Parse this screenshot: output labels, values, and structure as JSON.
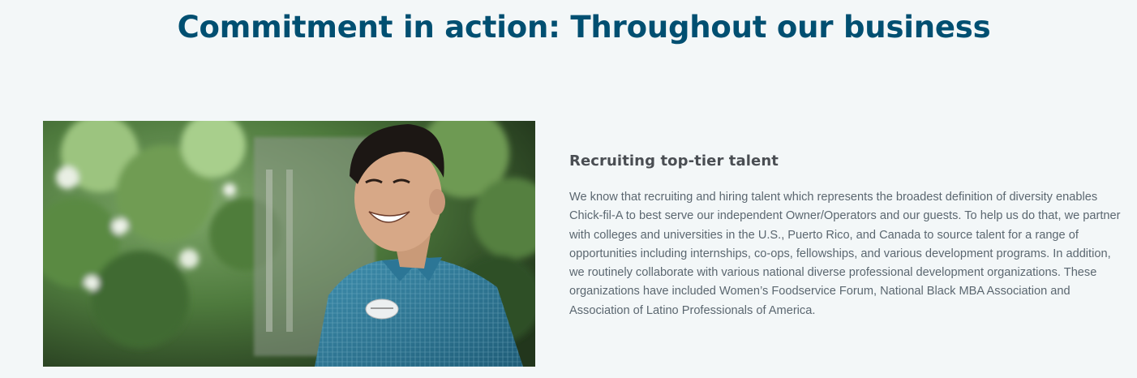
{
  "page": {
    "title": "Commitment in action: Throughout our business",
    "background_color": "#f3f7f8",
    "title_color": "#004f71"
  },
  "section": {
    "heading": "Recruiting top-tier talent",
    "body": "We know that recruiting and hiring talent which represents the broadest definition of diversity enables Chick-fil-A to best serve our independent Owner/Operators and our guests. To help us do that, we partner with colleges and universities in the U.S., Puerto Rico, and Canada to source talent for a range of opportunities including internships, co-ops, fellowships, and various development programs. In addition, we routinely collaborate with various national diverse professional development organizations. These organizations have included Women’s Foodservice Forum, National Black MBA Association and Association of Latino Professionals of America."
  },
  "image": {
    "subject": "smiling-man-blue-plaid-shirt-name-tag-outdoors"
  }
}
